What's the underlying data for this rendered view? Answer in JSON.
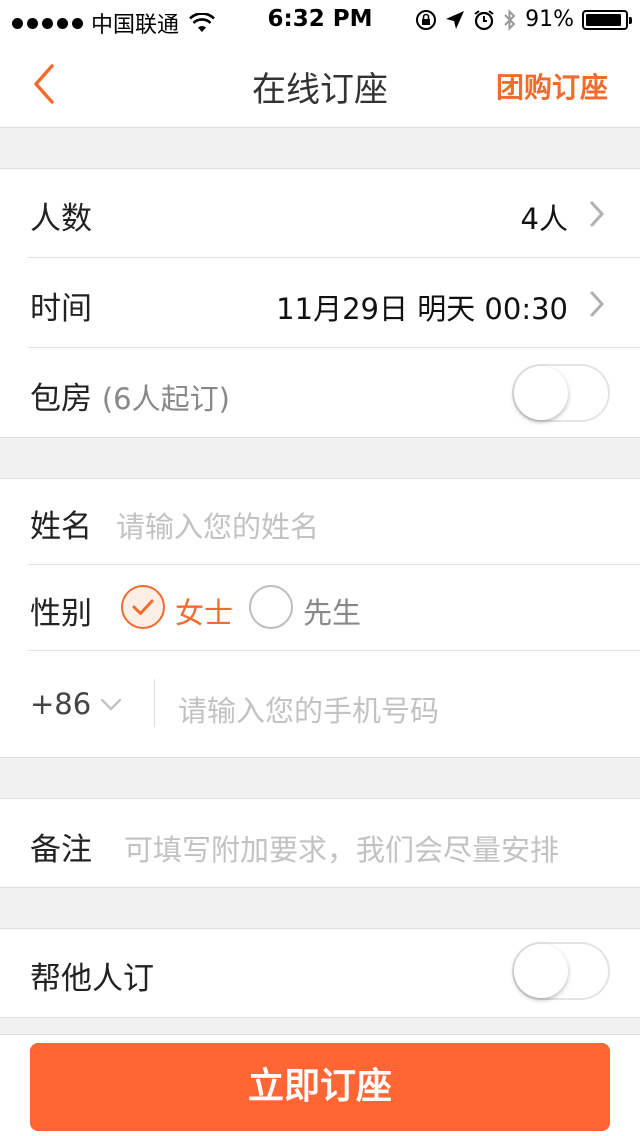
{
  "status_bar": {
    "carrier": "中国联通",
    "time": "6:32 PM",
    "battery": "91%",
    "battery_level": 0.91
  },
  "nav": {
    "title": "在线订座",
    "right_action": "团购订座"
  },
  "booking": {
    "people": {
      "label": "人数",
      "value": "4人"
    },
    "time": {
      "label": "时间",
      "value": "11月29日 明天 00:30"
    },
    "private_room": {
      "label": "包房",
      "note": "(6人起订)",
      "enabled": false
    }
  },
  "contact": {
    "name": {
      "label": "姓名",
      "placeholder": "请输入您的姓名"
    },
    "gender": {
      "label": "性别",
      "options": [
        "女士",
        "先生"
      ],
      "selected": "女士"
    },
    "phone": {
      "country_code": "+86",
      "placeholder": "请输入您的手机号码"
    }
  },
  "remark": {
    "label": "备注",
    "placeholder": "可填写附加要求，我们会尽量安排"
  },
  "book_for_others": {
    "label": "帮他人订",
    "enabled": false
  },
  "submit_label": "立即订座",
  "colors": {
    "accent": "#f26b2e",
    "button": "#ff6633",
    "background": "#f0f0f0"
  },
  "icons": [
    "wifi-icon",
    "orientation-lock-icon",
    "location-arrow-icon",
    "alarm-icon",
    "bluetooth-icon",
    "battery-icon",
    "back-chevron-icon",
    "chevron-right-icon",
    "chevron-down-icon",
    "check-icon"
  ]
}
